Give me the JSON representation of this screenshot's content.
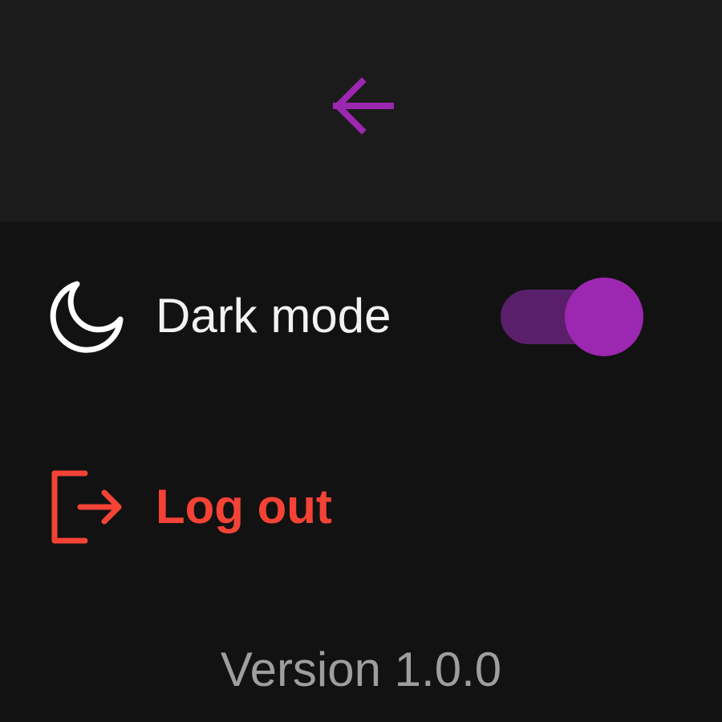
{
  "header": {
    "back_icon": "arrow-left-icon"
  },
  "settings": {
    "dark_mode": {
      "icon": "moon-icon",
      "label": "Dark mode",
      "enabled": true
    },
    "logout": {
      "icon": "logout-icon",
      "label": "Log out"
    }
  },
  "footer": {
    "version": "Version 1.0.0"
  },
  "colors": {
    "accent": "#9c27b0",
    "accent_track": "#5a1f6b",
    "danger": "#f44336",
    "header_bg": "#1b1b1b",
    "body_bg": "#121212",
    "muted_text": "#9e9e9e"
  }
}
